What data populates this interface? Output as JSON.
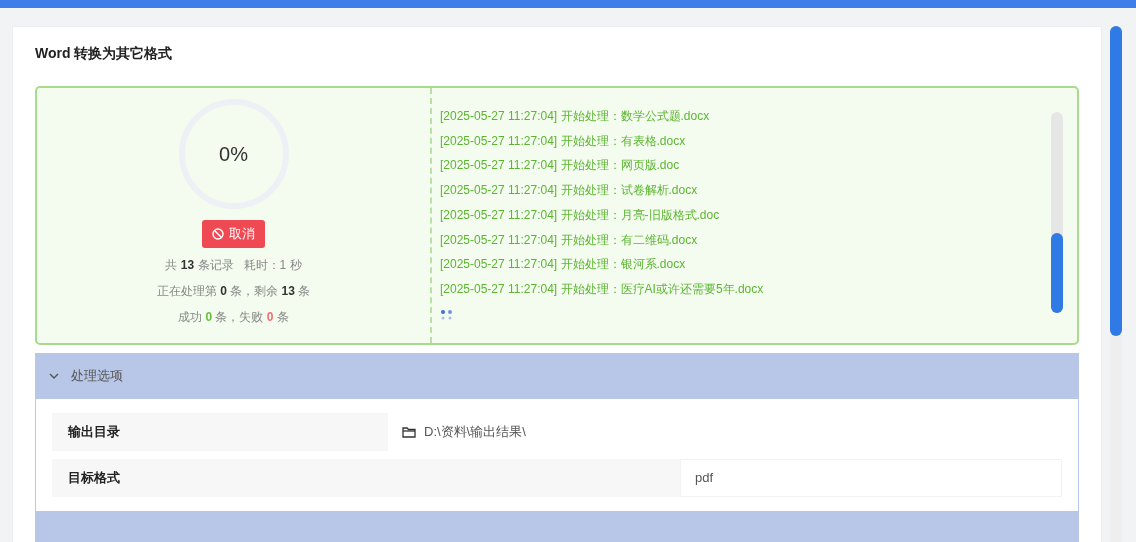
{
  "title": "Word 转换为其它格式",
  "progress": {
    "level": 0,
    "percent": "0%",
    "cancel_label": "取消",
    "stats": [
      [
        {
          "text": "共 "
        },
        {
          "text": "13",
          "kind": "count"
        },
        {
          "text": " 条记录   耗时：1 秒"
        }
      ],
      [
        {
          "text": "正在处理第 "
        },
        {
          "text": "0",
          "kind": "count"
        },
        {
          "text": " 条，剩余 "
        },
        {
          "text": "13",
          "kind": "count"
        },
        {
          "text": " 条"
        }
      ],
      [
        {
          "text": "成功 "
        },
        {
          "text": "0",
          "kind": "success"
        },
        {
          "text": " 条，失败 "
        },
        {
          "text": "0",
          "kind": "failure"
        },
        {
          "text": " 条"
        }
      ]
    ]
  },
  "log": [
    "[2025-05-27 11:27:04] 开始处理：数学公式题.docx",
    "[2025-05-27 11:27:04] 开始处理：有表格.docx",
    "[2025-05-27 11:27:04] 开始处理：网页版.doc",
    "[2025-05-27 11:27:04] 开始处理：试卷解析.docx",
    "[2025-05-27 11:27:04] 开始处理：月亮-旧版格式.doc",
    "[2025-05-27 11:27:04] 开始处理：有二维码.docx",
    "[2025-05-27 11:27:04] 开始处理：银河系.docx",
    "[2025-05-27 11:27:04] 开始处理：医疗AI或许还需要5年.docx"
  ],
  "options": {
    "title": "处理选项",
    "expanded": true,
    "rows": [
      {
        "label": "输出目录",
        "value": "D:\\资料\\输出结果\\",
        "kind": "folder"
      },
      {
        "label": "目标格式",
        "value": "pdf",
        "kind": "plain"
      }
    ]
  }
}
